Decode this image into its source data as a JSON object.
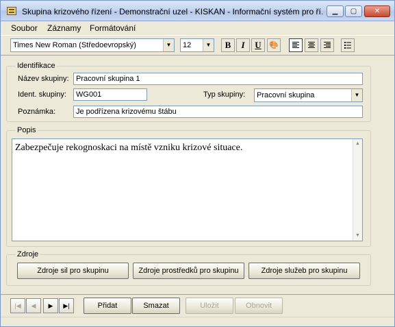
{
  "window": {
    "title": "Skupina krizového řízení - Demonstrační uzel - KISKAN - Informační systém pro ří...",
    "minimize_icon": "minimize-icon",
    "maximize_icon": "maximize-icon",
    "close_icon": "close-icon"
  },
  "menu": {
    "items": [
      {
        "label": "Soubor"
      },
      {
        "label": "Záznamy"
      },
      {
        "label": "Formátování"
      }
    ]
  },
  "toolbar": {
    "font_name": "Times New Roman (Středoevropský)",
    "font_size": "12",
    "bold_label": "B",
    "italic_label": "I",
    "underline_label": "U",
    "color_icon": "color-palette-icon",
    "align_left_icon": "align-left-icon",
    "align_center_icon": "align-center-icon",
    "align_right_icon": "align-right-icon",
    "bullets_icon": "bullet-list-icon"
  },
  "identifikace": {
    "legend": "Identifikace",
    "name_label": "Název skupiny:",
    "name_value": "Pracovní skupina 1",
    "ident_label": "Ident. skupiny:",
    "ident_value": "WG001",
    "type_label": "Typ skupiny:",
    "type_value": "Pracovní skupina",
    "note_label": "Poznámka:",
    "note_value": "Je podřízena krizovému štábu"
  },
  "popis": {
    "legend": "Popis",
    "text": "Zabezpečuje rekognoskaci na místě vzniku krizové situace."
  },
  "zdroje": {
    "legend": "Zdroje",
    "btn_sil": "Zdroje sil  pro skupinu",
    "btn_prostredku": "Zdroje prostředků pro skupinu",
    "btn_sluzeb": "Zdroje služeb pro skupinu"
  },
  "bottom": {
    "first": "|◀",
    "prev": "◀",
    "next": "▶",
    "last": "▶|",
    "add": "Přidat",
    "delete": "Smazat",
    "save": "Uložit",
    "refresh": "Obnovit"
  }
}
